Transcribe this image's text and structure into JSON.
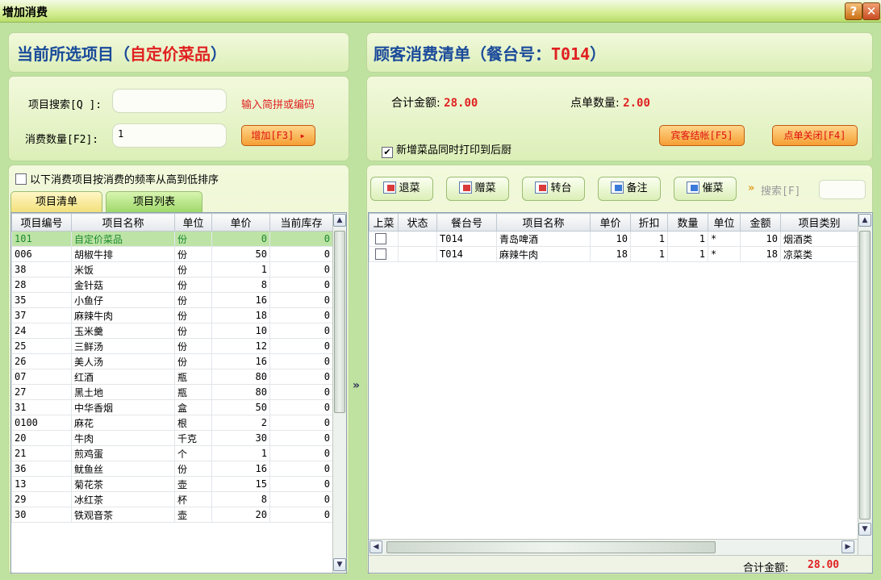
{
  "window": {
    "title": "增加消费",
    "help_icon": "?",
    "close_icon": "✕"
  },
  "left": {
    "title_prefix": "当前所选项目（",
    "title_item": "自定价菜品",
    "title_suffix": "）",
    "search_label": "项目搜索[Q ]:",
    "search_value": "",
    "search_hint": "输入简拼或编码",
    "qty_label": "消费数量[F2]:",
    "qty_value": "1",
    "add_button": "增加[F3]",
    "sort_label": "以下消费项目按消费的频率从高到低排序",
    "tabs": [
      "项目清单",
      "项目列表"
    ],
    "columns": [
      "项目编号",
      "项目名称",
      "单位",
      "单价",
      "当前库存"
    ],
    "rows": [
      [
        "101",
        "自定价菜品",
        "份",
        "0",
        "0"
      ],
      [
        "006",
        "胡椒牛排",
        "份",
        "50",
        "0"
      ],
      [
        "38",
        "米饭",
        "份",
        "1",
        "0"
      ],
      [
        "28",
        "金针菇",
        "份",
        "8",
        "0"
      ],
      [
        "35",
        "小鱼仔",
        "份",
        "16",
        "0"
      ],
      [
        "37",
        "麻辣牛肉",
        "份",
        "18",
        "0"
      ],
      [
        "24",
        "玉米羹",
        "份",
        "10",
        "0"
      ],
      [
        "25",
        "三鲜汤",
        "份",
        "12",
        "0"
      ],
      [
        "26",
        "美人汤",
        "份",
        "16",
        "0"
      ],
      [
        "07",
        "红酒",
        "瓶",
        "80",
        "0"
      ],
      [
        "27",
        "黑土地",
        "瓶",
        "80",
        "0"
      ],
      [
        "31",
        "中华香烟",
        "盒",
        "50",
        "0"
      ],
      [
        "0100",
        "麻花",
        "根",
        "2",
        "0"
      ],
      [
        "20",
        "牛肉",
        "千克",
        "30",
        "0"
      ],
      [
        "21",
        "煎鸡蛋",
        "个",
        "1",
        "0"
      ],
      [
        "36",
        "鱿鱼丝",
        "份",
        "16",
        "0"
      ],
      [
        "13",
        "菊花茶",
        "壶",
        "15",
        "0"
      ],
      [
        "29",
        "冰红茶",
        "杯",
        "8",
        "0"
      ],
      [
        "30",
        "铁观音茶",
        "壶",
        "20",
        "0"
      ]
    ]
  },
  "right": {
    "title_prefix": "顾客消费清单（餐台号：",
    "table_no": "T014",
    "title_suffix": "）",
    "total_label": "合计金额:",
    "total_value": "28.00",
    "count_label": "点单数量:",
    "count_value": "2.00",
    "print_label": "新增菜品同时打印到后厨",
    "print_checked": "✔",
    "checkout_button": "宾客结帐[F5]",
    "close_button": "点单关闭[F4]",
    "toolbar": [
      "退菜",
      "赠菜",
      "转台",
      "备注",
      "催菜"
    ],
    "search_label": "搜索[F]",
    "columns": [
      "上菜",
      "状态",
      "餐台号",
      "项目名称",
      "单价",
      "折扣",
      "数量",
      "单位",
      "金额",
      "项目类别"
    ],
    "rows": [
      [
        "",
        "",
        "T014",
        "青岛啤酒",
        "10",
        "1",
        "1",
        "*",
        "10",
        "烟酒类"
      ],
      [
        "",
        "",
        "T014",
        "麻辣牛肉",
        "18",
        "1",
        "1",
        "*",
        "18",
        "凉菜类"
      ]
    ],
    "footer_total_label": "合计金额:",
    "footer_total_value": "28.00"
  },
  "middle": {
    "expand_icon": "»"
  },
  "colors": {
    "accent_red": "#e02020",
    "title_blue": "#1a4a9a",
    "panel_green": "#dcefb8",
    "selected_row": "#bde3a6",
    "button_orange": "#f59f34"
  }
}
